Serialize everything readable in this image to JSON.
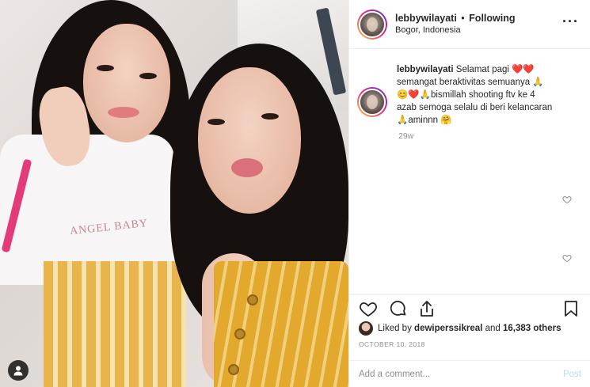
{
  "post": {
    "username": "lebbywilayati",
    "separator": "•",
    "follow_status": "Following",
    "location": "Bogor, Indonesia",
    "more_icon": "more-horizontal-icon"
  },
  "caption": {
    "username": "lebbywilayati",
    "line1": "Selamat pagi ❤️❤️",
    "line2": "semangat beraktivitas semuanya 🙏",
    "line3": "😊❤️🙏bismillah shooting ftv ke 4",
    "line4": "azab semoga selalu di beri kelancaran",
    "line5": "🙏aminnn 🤗",
    "age": "29w"
  },
  "actions": {
    "like_icon": "heart-icon",
    "comment_icon": "comment-icon",
    "share_icon": "share-icon",
    "save_icon": "bookmark-icon"
  },
  "likes": {
    "prefix": "Liked by ",
    "user": "dewiperssikreal",
    "middle": " and ",
    "count": "16,383 others"
  },
  "date": "OCTOBER 10, 2018",
  "comment": {
    "placeholder": "Add a comment...",
    "post_label": "Post"
  },
  "colors": {
    "accent_blue_disabled": "#b2dffc",
    "muted": "#8e8e8e",
    "text": "#262626"
  }
}
